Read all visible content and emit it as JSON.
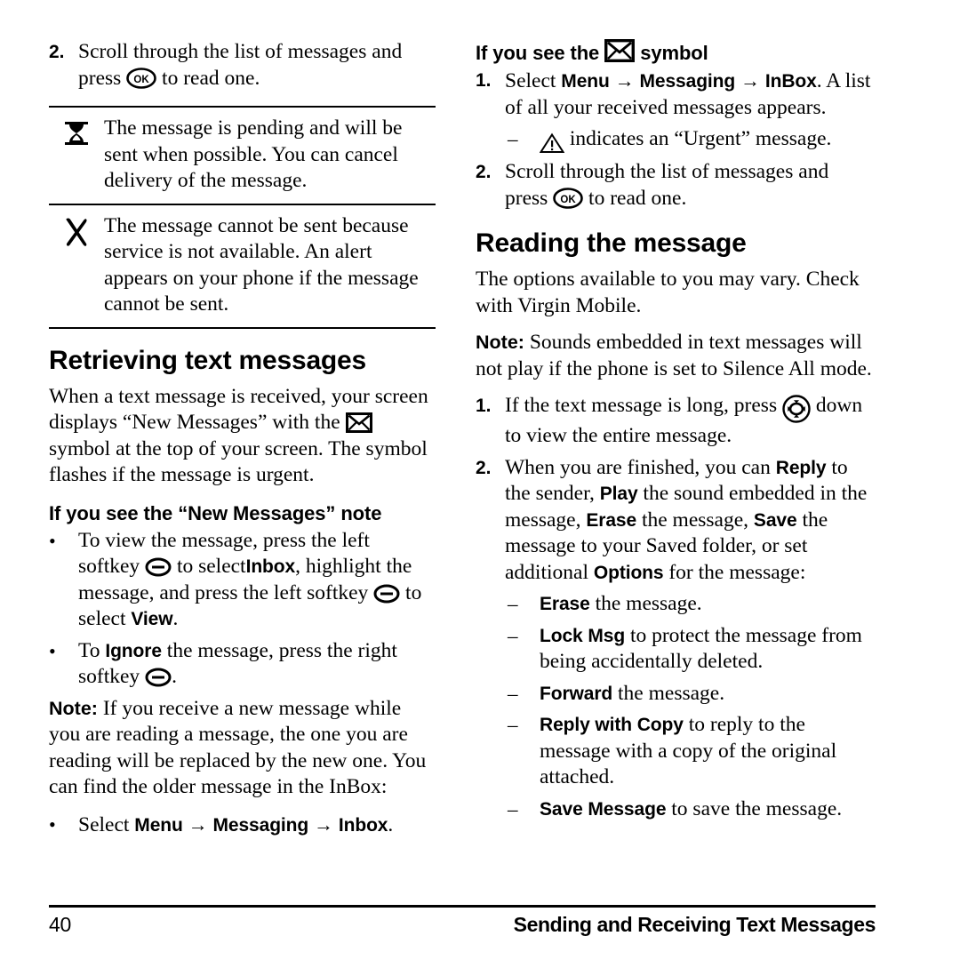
{
  "document": {
    "page_number": "40",
    "footer_title": "Sending and Receiving Text Messages"
  },
  "left_column": {
    "step_2": {
      "marker": "2.",
      "text_before_icon": "Scroll through the list of messages and press",
      "icon": "ok-key-icon",
      "text_after_icon": "to read one."
    },
    "status_icon_table": [
      {
        "icon": "hourglass-icon",
        "text": "The message is pending and will be sent when possible. You can cancel delivery of the message."
      },
      {
        "icon": "x-mark-icon",
        "text": "The message cannot be sent because service is not available. An alert appears on your phone if the message cannot be sent."
      }
    ],
    "heading_retrieving": "Retrieving text messages",
    "intro_part1": "When a text message is received, your screen displays “New Messages” with the",
    "intro_icon": "envelope-icon",
    "intro_part2": "symbol at the top of your screen. The symbol flashes if the message is urgent.",
    "subheading_new_messages": "If you see the “New Messages” note",
    "bullets": [
      {
        "marker": "•",
        "seg1": "To view the message, press the left softkey",
        "icon1": "softkey-icon",
        "seg2": "to select",
        "ui1": "Inbox",
        "seg3": ", highlight the message, and press the left softkey",
        "icon2": "softkey-icon",
        "seg4": "to select",
        "ui2": "View",
        "seg5": "."
      },
      {
        "marker": "•",
        "seg1": "To",
        "ui1": "Ignore",
        "seg2": "the message, press the right softkey",
        "icon1": "softkey-icon",
        "seg3": "."
      }
    ],
    "note": {
      "lead": "Note:",
      "text": "If you receive a new message while you are reading a message, the one you are reading will be replaced by the new one. You can find the older message in the InBox:"
    },
    "note_bullet": {
      "marker": "•",
      "seg1": "Select",
      "ui1": "Menu",
      "arrow1": "→",
      "ui2": "Messaging",
      "arrow2": "→",
      "ui3": "Inbox",
      "seg2": "."
    }
  },
  "right_column": {
    "heading_symbol": {
      "text_before": "If you see the",
      "icon": "envelope-icon",
      "text_after": "symbol"
    },
    "step_1": {
      "marker": "1.",
      "seg1": "Select",
      "ui1": "Menu",
      "arrow1": "→",
      "ui2": "Messaging",
      "arrow2": "→",
      "ui3": "InBox",
      "seg2": ". A list of all your received messages appears."
    },
    "step_1_sub": {
      "marker": "–",
      "icon": "warning-triangle-icon",
      "text": "indicates an “Urgent” message."
    },
    "step_2": {
      "marker": "2.",
      "text_before_icon": "Scroll through the list of messages and press",
      "icon": "ok-key-icon",
      "text_after_icon": "to read one."
    },
    "heading_reading": "Reading the message",
    "options_vary": "The options available to you may vary. Check with Virgin Mobile.",
    "note": {
      "lead": "Note:",
      "text": "Sounds embedded in text messages will not play if the phone is set to Silence All mode."
    },
    "reading_step_1": {
      "marker": "1.",
      "text_before_icon": "If the text message is long, press",
      "icon": "navigation-key-icon",
      "text_after_icon": "down to view the entire message."
    },
    "reading_step_2": {
      "marker": "2.",
      "seg1": "When you are finished, you can",
      "ui1": "Reply",
      "seg2": "to the sender,",
      "ui2": "Play",
      "seg3": "the sound embedded in the message,",
      "ui3": "Erase",
      "seg4": "the message,",
      "ui4": "Save",
      "seg5": "the message to your Saved folder, or set additional",
      "ui5": "Options",
      "seg6": "for the message:"
    },
    "option_items": [
      {
        "marker": "–",
        "ui": "Erase",
        "text": "the message."
      },
      {
        "marker": "–",
        "ui": "Lock Msg",
        "text": "to protect the message from being accidentally deleted."
      },
      {
        "marker": "–",
        "ui": "Forward",
        "text": "the message."
      },
      {
        "marker": "–",
        "ui": "Reply with Copy",
        "text": "to reply to the message with a copy of the original attached."
      },
      {
        "marker": "–",
        "ui": "Save Message",
        "text": "to save the message."
      }
    ]
  }
}
